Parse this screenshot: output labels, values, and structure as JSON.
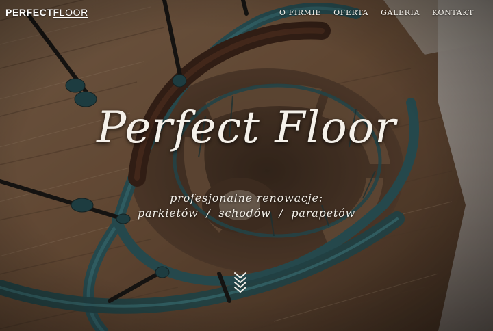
{
  "brand": {
    "bold": "PERFECT",
    "light": "FLOOR"
  },
  "nav": {
    "items": [
      {
        "label": "O FIRMIE"
      },
      {
        "label": "OFERTA"
      },
      {
        "label": "GALERIA"
      },
      {
        "label": "KONTAKT"
      }
    ]
  },
  "hero": {
    "title": "Perfect Floor",
    "subtitle_line1": "profesjonalne renowacje:",
    "subtitle_line2": "parkietów  /  schodów  /  parapetów",
    "scroll_icon": "double-chevron-down-icon"
  },
  "colors": {
    "text": "#f5f1ea",
    "railing": "#2f6a72",
    "wood": "#9b7a5b"
  }
}
